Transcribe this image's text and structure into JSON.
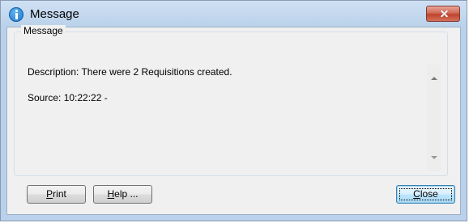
{
  "window": {
    "title": "Message",
    "title_icon": "info-icon",
    "close_icon": "close-icon"
  },
  "group": {
    "caption": "Message"
  },
  "message": {
    "description": "Description: There were 2 Requisitions created.",
    "source": "Source:  10:22:22 -"
  },
  "buttons": {
    "print_prefix": "",
    "print_mnemonic": "P",
    "print_rest": "rint",
    "help_mnemonic": "H",
    "help_rest": "elp ...",
    "close_mnemonic": "C",
    "close_rest": "lose"
  },
  "colors": {
    "title_bar": "#b9d1ea",
    "close_button": "#c1432d",
    "dialog_background": "#f0f0f0",
    "default_button_border": "#3c7fb1"
  }
}
